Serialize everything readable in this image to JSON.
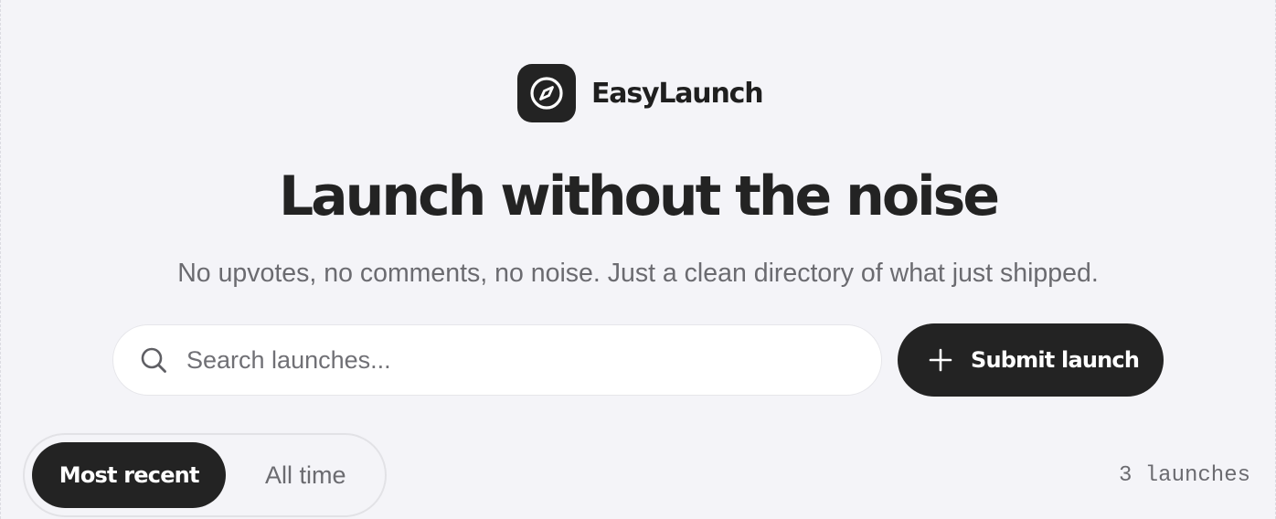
{
  "brand": {
    "name": "EasyLaunch",
    "icon": "compass-icon"
  },
  "hero": {
    "headline": "Launch without the noise",
    "subheadline": "No upvotes, no comments, no noise. Just a clean directory of what just shipped."
  },
  "search": {
    "placeholder": "Search launches...",
    "value": "",
    "icon": "search-icon"
  },
  "submit": {
    "label": "Submit launch",
    "icon": "plus-icon"
  },
  "tabs": [
    {
      "label": "Most recent",
      "active": true
    },
    {
      "label": "All time",
      "active": false
    }
  ],
  "results": {
    "count_label": "3 launches"
  },
  "colors": {
    "background": "#f4f4f8",
    "primary": "#232323",
    "muted_text": "#6b6b70",
    "surface": "#ffffff"
  }
}
